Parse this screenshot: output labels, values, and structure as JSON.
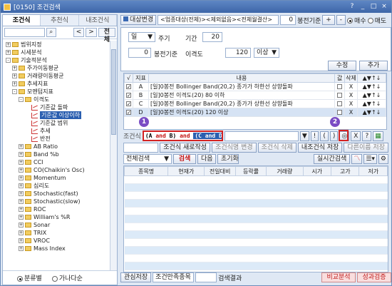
{
  "window": {
    "title": "[0150] 조건검색",
    "controls": [
      "?",
      "_",
      "□",
      "×"
    ]
  },
  "left": {
    "tabs": [
      "조건식",
      "추천식",
      "내조건식"
    ],
    "search_btns": [
      "<",
      ">",
      "전체"
    ],
    "tree": [
      {
        "label": "범위지정",
        "level": 0,
        "type": "folder",
        "exp": "+"
      },
      {
        "label": "시세분석",
        "level": 0,
        "type": "folder",
        "exp": "+"
      },
      {
        "label": "기술적분석",
        "level": 0,
        "type": "folder",
        "exp": "-"
      },
      {
        "label": "주가이동평균",
        "level": 1,
        "type": "folder",
        "exp": "+"
      },
      {
        "label": "거래량이동평균",
        "level": 1,
        "type": "folder",
        "exp": "+"
      },
      {
        "label": "추세지표",
        "level": 1,
        "type": "folder",
        "exp": "+"
      },
      {
        "label": "모멘텀지표",
        "level": 1,
        "type": "folder",
        "exp": "-"
      },
      {
        "label": "이격도",
        "level": 2,
        "type": "folder",
        "exp": "-"
      },
      {
        "label": "기준값 돌파",
        "level": 3,
        "type": "graph"
      },
      {
        "label": "기준값 이상이하",
        "level": 3,
        "type": "graph",
        "sel": true
      },
      {
        "label": "기준값 범위",
        "level": 3,
        "type": "graph"
      },
      {
        "label": "추세",
        "level": 3,
        "type": "graph"
      },
      {
        "label": "반전",
        "level": 3,
        "type": "graph"
      },
      {
        "label": "AB Ratio",
        "level": 2,
        "type": "folder",
        "exp": "+"
      },
      {
        "label": "Band %b",
        "level": 2,
        "type": "folder",
        "exp": "+"
      },
      {
        "label": "CCI",
        "level": 2,
        "type": "folder",
        "exp": "+"
      },
      {
        "label": "CO(Chaikin's Osc)",
        "level": 2,
        "type": "folder",
        "exp": "+"
      },
      {
        "label": "Momentum",
        "level": 2,
        "type": "folder",
        "exp": "+"
      },
      {
        "label": "심리도",
        "level": 2,
        "type": "folder",
        "exp": "+"
      },
      {
        "label": "Stochastic(fast)",
        "level": 2,
        "type": "folder",
        "exp": "+"
      },
      {
        "label": "Stochastic(slow)",
        "level": 2,
        "type": "folder",
        "exp": "+"
      },
      {
        "label": "ROC",
        "level": 2,
        "type": "folder",
        "exp": "+"
      },
      {
        "label": "William's %R",
        "level": 2,
        "type": "folder",
        "exp": "+"
      },
      {
        "label": "Sonar",
        "level": 2,
        "type": "folder",
        "exp": "+"
      },
      {
        "label": "TRIX",
        "level": 2,
        "type": "folder",
        "exp": "+"
      },
      {
        "label": "VROC",
        "level": 2,
        "type": "folder",
        "exp": "+"
      },
      {
        "label": "Mass Index",
        "level": 2,
        "type": "folder",
        "exp": "+"
      }
    ],
    "bottom": {
      "opt1": "분류별",
      "opt2": "가나다순"
    }
  },
  "top": {
    "target_btn": "대상변경",
    "target_text": "<업종대상(전체)><제외없음><전체월결산>",
    "num_value": "0",
    "basis": "봉전기준",
    "plus": "+",
    "minus": "-",
    "buy": "매수",
    "sell": "매도"
  },
  "settings": {
    "period_value": "일",
    "period_label": "주기",
    "ago_value": "0",
    "ago_label": "봉전기준",
    "term_label": "기간",
    "term_value": "20",
    "gap_label": "이격도",
    "gap_value": "120",
    "cmp_value": "이상",
    "modify": "수정",
    "add": "추가"
  },
  "cond_grid": {
    "headers": [
      "√",
      "지표",
      "내용",
      "값",
      "삭제",
      "▲▼↑↓"
    ],
    "rows": [
      {
        "letter": "A",
        "content": "[일]0봉전 Bollinger Band(20,2) 종가가 하한선 상향돌파",
        "del": "X",
        "arrows": "▲▼↑↓"
      },
      {
        "letter": "B",
        "content": "[일]0봉전 이격도(20) 80 이하",
        "del": "X",
        "arrows": "▲▼↑↓"
      },
      {
        "letter": "C",
        "content": "[일]0봉전 Bollinger Band(20,2) 종가가 상한선 상향돌파",
        "del": "X",
        "arrows": "▲▼↑↓"
      },
      {
        "letter": "D",
        "content": "[일]0봉전 이격도(20) 120 이상",
        "del": "X",
        "arrows": "▲▼↑↓"
      }
    ]
  },
  "condition": {
    "label": "조건식",
    "p1": "(A",
    "op1": "and",
    "p2": "B)",
    "op2": "and",
    "p3": "(C and D)",
    "btns": [
      "!",
      "(",
      ")",
      "X",
      "?"
    ],
    "marker1": "1",
    "marker2": "2"
  },
  "row3": {
    "btns": [
      "조건식 새로작성",
      "조건식명 변경",
      "조건식 삭제",
      "내조건식 저장",
      "다른이름 저장"
    ]
  },
  "row4": {
    "select": "전체검색",
    "search": "검색",
    "next": "다음",
    "reset": "초기화",
    "realtime": "실시간검색"
  },
  "result": {
    "headers": [
      "종목명",
      "현재가",
      "전일대비",
      "등락률",
      "거래량",
      "시가",
      "고가",
      "저가"
    ],
    "rows": 12
  },
  "bottom": {
    "save_btn": "관심저장",
    "match_label": "조건만족종목",
    "result_label": "검색결과",
    "compare": "비교분석",
    "perf": "성과검증"
  }
}
